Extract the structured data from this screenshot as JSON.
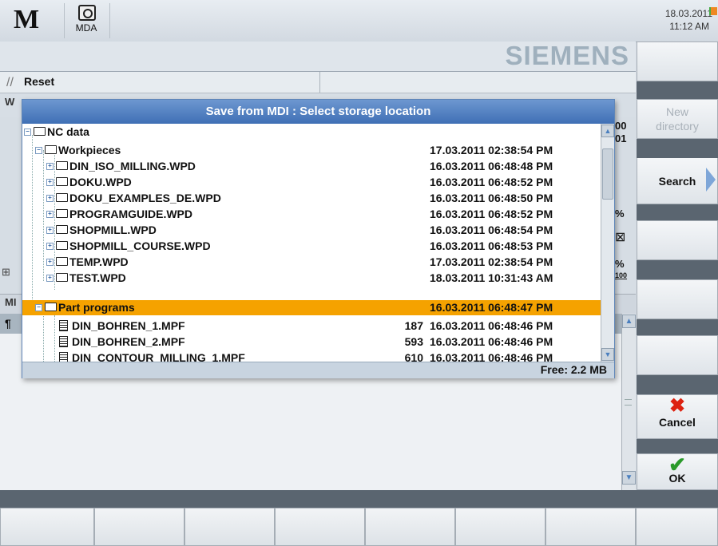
{
  "header": {
    "logo": "M",
    "mode_label": "MDA",
    "date": "18.03.2011",
    "time": "11:12 AM",
    "brand": "SIEMENS"
  },
  "status": {
    "reset_label": "Reset"
  },
  "background": {
    "w_label": "W",
    "ml_label": "MI",
    "para": "¶",
    "gutter": "⊞",
    "right_values": [
      "00",
      "01"
    ],
    "right_percent1": "%",
    "right_symbol": "⊠",
    "right_percent2": "%",
    "right_small": "100"
  },
  "dialog": {
    "title": "Save from MDI : Select storage location",
    "free_space": "Free: 2.2 MB",
    "rows": [
      {
        "name": "NC data",
        "size": "",
        "date": ""
      },
      {
        "name": "Workpieces",
        "size": "",
        "date": "17.03.2011  02:38:54 PM"
      },
      {
        "name": "DIN_ISO_MILLING.WPD",
        "size": "",
        "date": "16.03.2011  06:48:48 PM"
      },
      {
        "name": "DOKU.WPD",
        "size": "",
        "date": "16.03.2011  06:48:52 PM"
      },
      {
        "name": "DOKU_EXAMPLES_DE.WPD",
        "size": "",
        "date": "16.03.2011  06:48:50 PM"
      },
      {
        "name": "PROGRAMGUIDE.WPD",
        "size": "",
        "date": "16.03.2011  06:48:52 PM"
      },
      {
        "name": "SHOPMILL.WPD",
        "size": "",
        "date": "16.03.2011  06:48:54 PM"
      },
      {
        "name": "SHOPMILL_COURSE.WPD",
        "size": "",
        "date": "16.03.2011  06:48:53 PM"
      },
      {
        "name": "TEMP.WPD",
        "size": "",
        "date": "17.03.2011  02:38:54 PM"
      },
      {
        "name": "TEST.WPD",
        "size": "",
        "date": "18.03.2011  10:31:43 AM"
      },
      {
        "name": "Part programs",
        "size": "",
        "date": "16.03.2011  06:48:47 PM"
      },
      {
        "name": "DIN_BOHREN_1.MPF",
        "size": "187",
        "date": "16.03.2011  06:48:46 PM"
      },
      {
        "name": "DIN_BOHREN_2.MPF",
        "size": "593",
        "date": "16.03.2011  06:48:46 PM"
      },
      {
        "name": "DIN_CONTOUR_MILLING_1.MPF",
        "size": "610",
        "date": "16.03.2011  06:48:46 PM"
      }
    ]
  },
  "softkeys": {
    "new_directory": "New directory",
    "search": "Search",
    "cancel": "Cancel",
    "ok": "OK"
  },
  "colors": {
    "selection": "#f5a200",
    "title_bar": "#3f6fb5"
  }
}
